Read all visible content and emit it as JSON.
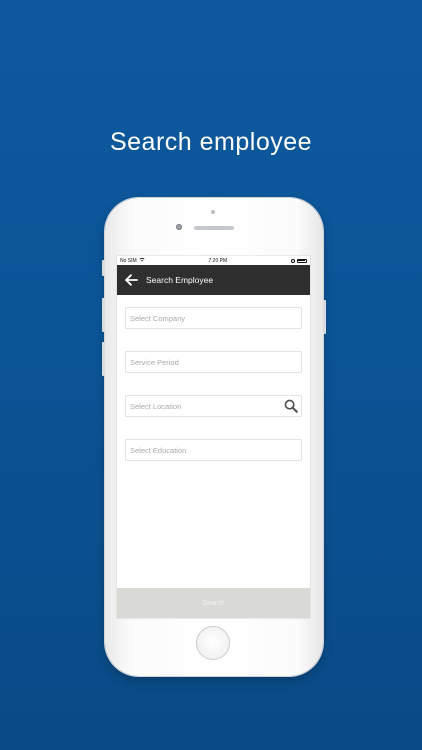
{
  "headline": "Search employee",
  "status_bar": {
    "carrier": "No SIM",
    "time": "7:20 PM"
  },
  "app_bar": {
    "title": "Search Employee"
  },
  "form": {
    "company_placeholder": "Select Company",
    "service_period_placeholder": "Service Period",
    "location_placeholder": "Select Location",
    "education_placeholder": "Select Education"
  },
  "actions": {
    "search_label": "Search"
  },
  "icons": {
    "back": "arrow-left-icon",
    "search": "magnifier-icon",
    "wifi": "wifi-icon",
    "battery": "battery-icon",
    "lock": "rotation-lock-icon"
  },
  "colors": {
    "background": "#0b5496",
    "app_bar": "#2f2f2f",
    "search_button": "#d9d9d6"
  }
}
